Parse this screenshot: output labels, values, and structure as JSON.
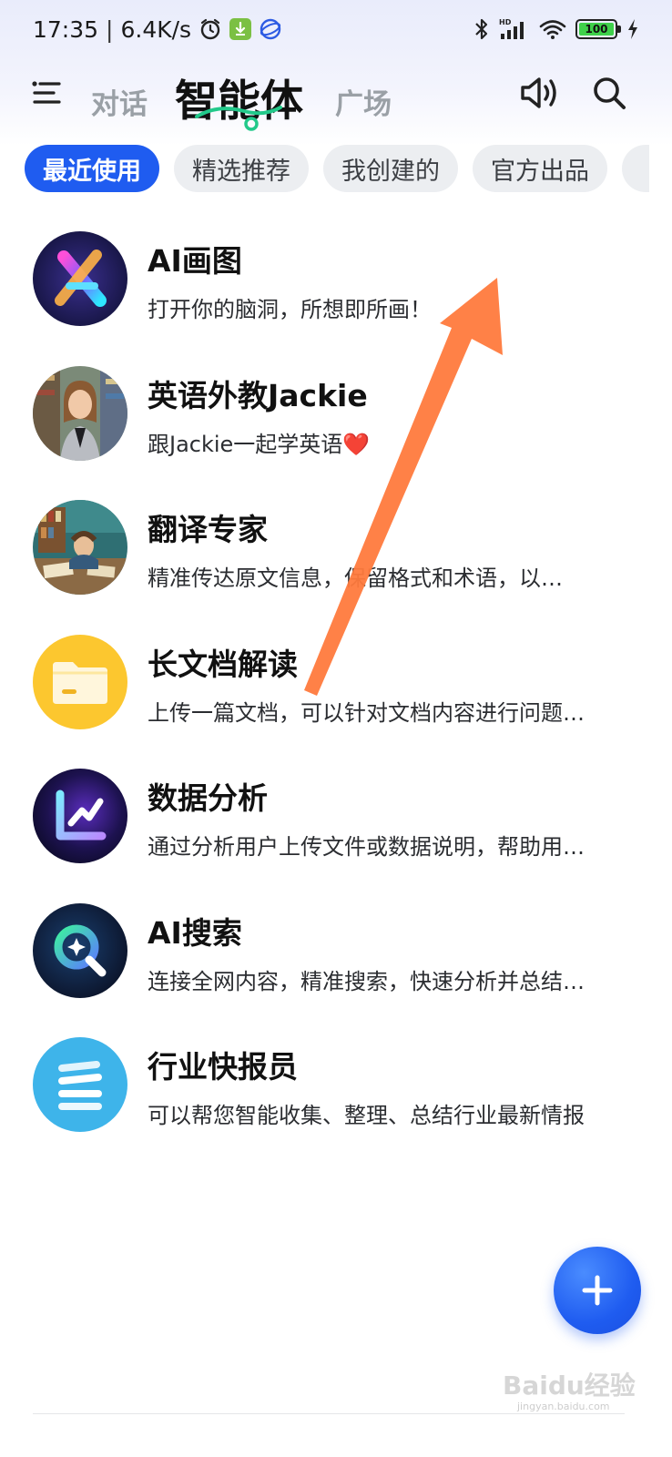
{
  "status_bar": {
    "time": "17:35",
    "separator": "|",
    "speed": "6.4K/s",
    "battery": "100"
  },
  "header": {
    "tabs": [
      {
        "label": "对话"
      },
      {
        "label": "智能体",
        "active": true
      },
      {
        "label": "广场"
      }
    ],
    "icons": [
      "menu-icon",
      "speaker-icon",
      "search-icon"
    ]
  },
  "filters": [
    {
      "label": "最近使用",
      "active": true
    },
    {
      "label": "精选推荐"
    },
    {
      "label": "我创建的"
    },
    {
      "label": "官方出品"
    }
  ],
  "agents": [
    {
      "name": "AI画图",
      "desc": "打开你的脑洞，所想即所画！",
      "avatar": "ai-drawing-avatar"
    },
    {
      "name": "英语外教Jackie",
      "desc": "跟Jackie一起学英语❤️",
      "avatar": "jackie-avatar"
    },
    {
      "name": "翻译专家",
      "desc": "精准传达原文信息，保留格式和术语，以…",
      "avatar": "translator-avatar"
    },
    {
      "name": "长文档解读",
      "desc": "上传一篇文档，可以针对文档内容进行问题…",
      "avatar": "document-avatar"
    },
    {
      "name": "数据分析",
      "desc": "通过分析用户上传文件或数据说明，帮助用…",
      "avatar": "data-analysis-avatar"
    },
    {
      "name": "AI搜索",
      "desc": "连接全网内容，精准搜索，快速分析并总结…",
      "avatar": "ai-search-avatar"
    },
    {
      "name": "行业快报员",
      "desc": "可以帮您智能收集、整理、总结行业最新情报",
      "avatar": "news-reporter-avatar"
    }
  ],
  "fab": {
    "icon": "plus-icon"
  },
  "watermark": {
    "text": "Baidu经验",
    "sub": "jingyan.baidu.com"
  },
  "colors": {
    "accent": "#1f5cf0",
    "arrow": "#ff7a3d",
    "chip_bg": "#eceef1"
  }
}
